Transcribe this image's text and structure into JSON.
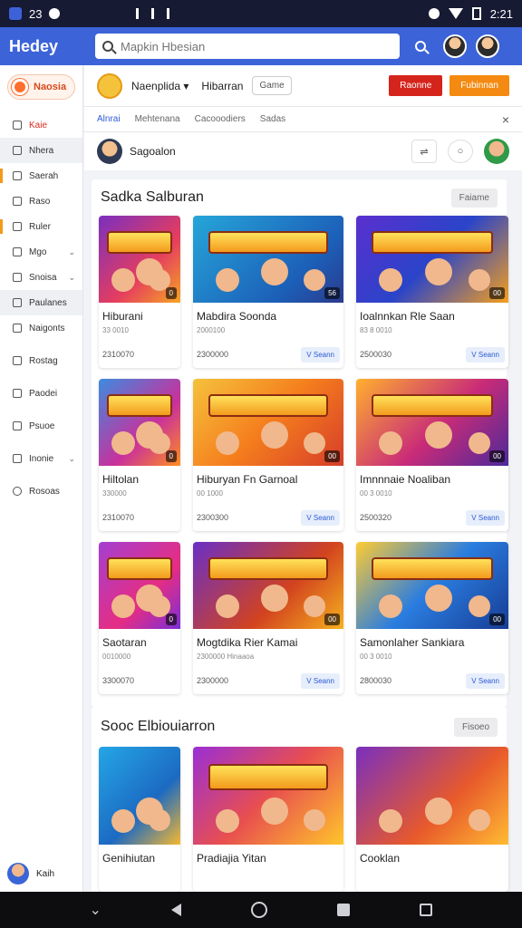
{
  "statusbar": {
    "time": "23",
    "right_time": "2:21"
  },
  "topbar": {
    "brand": "Hedey",
    "search_placeholder": "Mapkin Hbesian"
  },
  "sidebar": {
    "brand": "Naosia",
    "items": [
      {
        "label": "Kaie",
        "icon": "home-icon"
      },
      {
        "label": "Nhera",
        "icon": "list-icon"
      },
      {
        "label": "Saerah",
        "icon": "book-icon"
      },
      {
        "label": "Raso",
        "icon": "doc-icon"
      },
      {
        "label": "Ruler",
        "icon": "ruler-icon"
      },
      {
        "label": "Mgo",
        "icon": "folder-icon"
      },
      {
        "label": "Snoisa",
        "icon": "home2-icon"
      },
      {
        "label": "Paulanes",
        "icon": "grid-icon"
      },
      {
        "label": "Naigonts",
        "icon": "people-icon"
      },
      {
        "label": "Rostag",
        "icon": "tag-icon"
      },
      {
        "label": "Paodei",
        "icon": "lock-icon"
      },
      {
        "label": "Psuoe",
        "icon": "pause-icon"
      },
      {
        "label": "Inonie",
        "icon": "info-icon"
      },
      {
        "label": "Rosoas",
        "icon": "gear-icon"
      }
    ],
    "user": "Kaih"
  },
  "header": {
    "title": "Naenplida",
    "title2": "Hibarran",
    "chip": "Game",
    "btn_red": "Raonne",
    "btn_orange": "Fubinnan"
  },
  "tabs": [
    "Alnrai",
    "Mehtenana",
    "Cacooodiers",
    "Sadas"
  ],
  "info": {
    "name": "Sagoalon"
  },
  "section1": {
    "title": "Sadka Salburan",
    "button": "Faiame",
    "cards": [
      {
        "title": "Hiburani",
        "sub": "33 0010",
        "price": "2310070",
        "btn": "",
        "badge": "0"
      },
      {
        "title": "Mabdira Soonda",
        "sub": "2000100",
        "price": "2300000",
        "btn": "V Seann",
        "badge": "56"
      },
      {
        "title": "Ioalnnkan Rle Saan",
        "sub": "83 8 0010",
        "price": "2500030",
        "btn": "V Seann",
        "badge": "00"
      },
      {
        "title": "Hiltolan",
        "sub": "330000",
        "price": "2310070",
        "btn": "",
        "badge": "0"
      },
      {
        "title": "Hiburyan Fn Garnoal",
        "sub": "00 1000",
        "price": "2300300",
        "btn": "V Seann",
        "badge": "00"
      },
      {
        "title": "Imnnnaie Noaliban",
        "sub": "00 3 0010",
        "price": "2500320",
        "btn": "V Seann",
        "badge": "00"
      },
      {
        "title": "Saotaran",
        "sub": "0010000",
        "price": "3300070",
        "btn": "",
        "badge": "0"
      },
      {
        "title": "Mogtdika Rier Kamai",
        "sub": "2300000 Hinaaoa",
        "price": "2300000",
        "btn": "V Seann",
        "badge": "00"
      },
      {
        "title": "Samonlaher Sankiara",
        "sub": "00 3 0010",
        "price": "2800030",
        "btn": "V Seann",
        "badge": "00"
      }
    ]
  },
  "section2": {
    "title": "Sooc Elbiouiarron",
    "button": "Fisoeo",
    "cards": [
      {
        "title": "Genihiutan",
        "badge": ""
      },
      {
        "title": "Pradiajia Yitan",
        "badge": ""
      },
      {
        "title": "Cooklan",
        "badge": ""
      }
    ]
  },
  "colors": {
    "primary": "#3c63d7",
    "statusbar": "#161a33",
    "red": "#d5241c",
    "orange": "#f48a12"
  },
  "thumbs": [
    {
      "bg": "linear-gradient(135deg,#7a2fbf,#e53d5f 60%,#f5a623)",
      "banner": "MEPONIA"
    },
    {
      "bg": "linear-gradient(135deg,#26a6d9,#1c5fb8 70%,#2b3a8c)",
      "banner": "MABBAR"
    },
    {
      "bg": "linear-gradient(135deg,#5b2fcf,#2a44c9 50%,#f59f1d)",
      "banner": "MIGEON HAPOANS"
    },
    {
      "bg": "linear-gradient(135deg,#3d8be0,#c9309c 60%,#ff8f1f)",
      "banner": "HIED"
    },
    {
      "bg": "linear-gradient(135deg,#f5c23c,#f57e1d 50%,#d63d2a)",
      "banner": "SOODAR"
    },
    {
      "bg": "linear-gradient(135deg,#ffb02e,#c92b78 55%,#4b2a9a)",
      "banner": "KOOAN ELBHAS"
    },
    {
      "bg": "linear-gradient(135deg,#a33fd1,#e62d83 60%,#7b2fd6)",
      "banner": "MONENI"
    },
    {
      "bg": "linear-gradient(135deg,#6a2fc6,#d2431f 60%,#f5b11f)",
      "banner": "WEKIOI SALING"
    },
    {
      "bg": "linear-gradient(135deg,#ffcc33,#2a7de0 50%,#173c94)",
      "banner": "NOOIBAS"
    },
    {
      "bg": "linear-gradient(135deg,#24a6e6,#1c6ac2 60%,#f5b731)",
      "banner": ""
    },
    {
      "bg": "linear-gradient(135deg,#9a2ed6,#e84f4f 50%,#ffc52b)",
      "banner": "MINDON"
    },
    {
      "bg": "linear-gradient(135deg,#7a2fbf,#e85a2b 60%,#ffbb33)",
      "banner": ""
    }
  ]
}
